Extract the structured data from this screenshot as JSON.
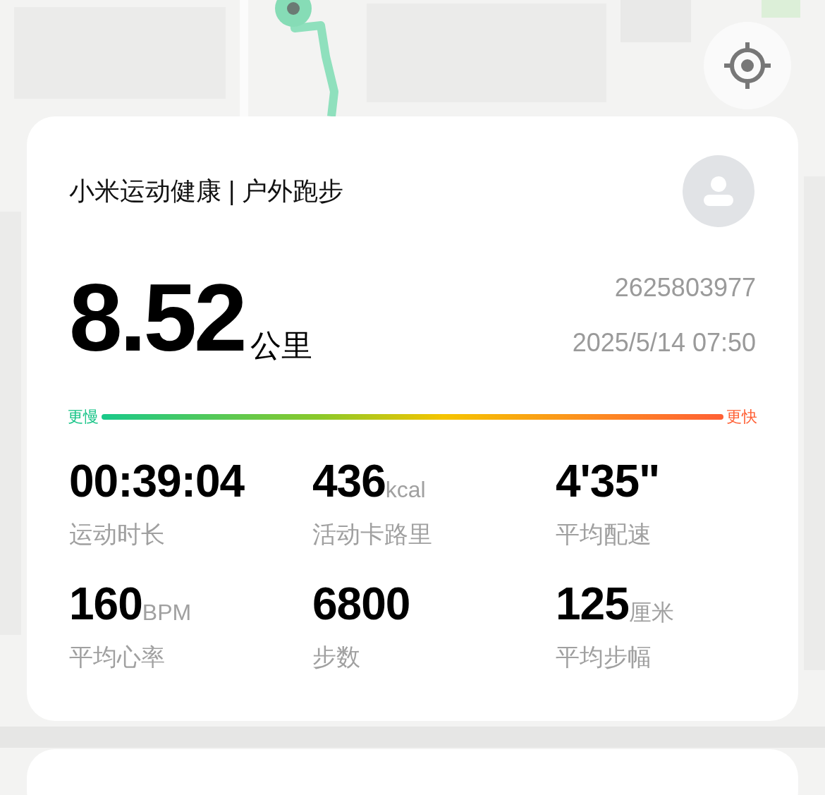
{
  "app_title": "小米运动健康 | 户外跑步",
  "distance": {
    "value": "8.52",
    "unit": "公里"
  },
  "account_id": "2625803977",
  "datetime": "2025/5/14 07:50",
  "pace_scale": {
    "slow_label": "更慢",
    "fast_label": "更快"
  },
  "stats": [
    {
      "value": "00:39:04",
      "label": "运动时长"
    },
    {
      "value": "436",
      "unit": "kcal",
      "label": "活动卡路里"
    },
    {
      "value": "4'35\"",
      "label": "平均配速"
    },
    {
      "value": "160",
      "unit": "BPM",
      "label": "平均心率"
    },
    {
      "value": "6800",
      "label": "步数"
    },
    {
      "value": "125",
      "unit": "厘米",
      "label": "平均步幅"
    }
  ]
}
